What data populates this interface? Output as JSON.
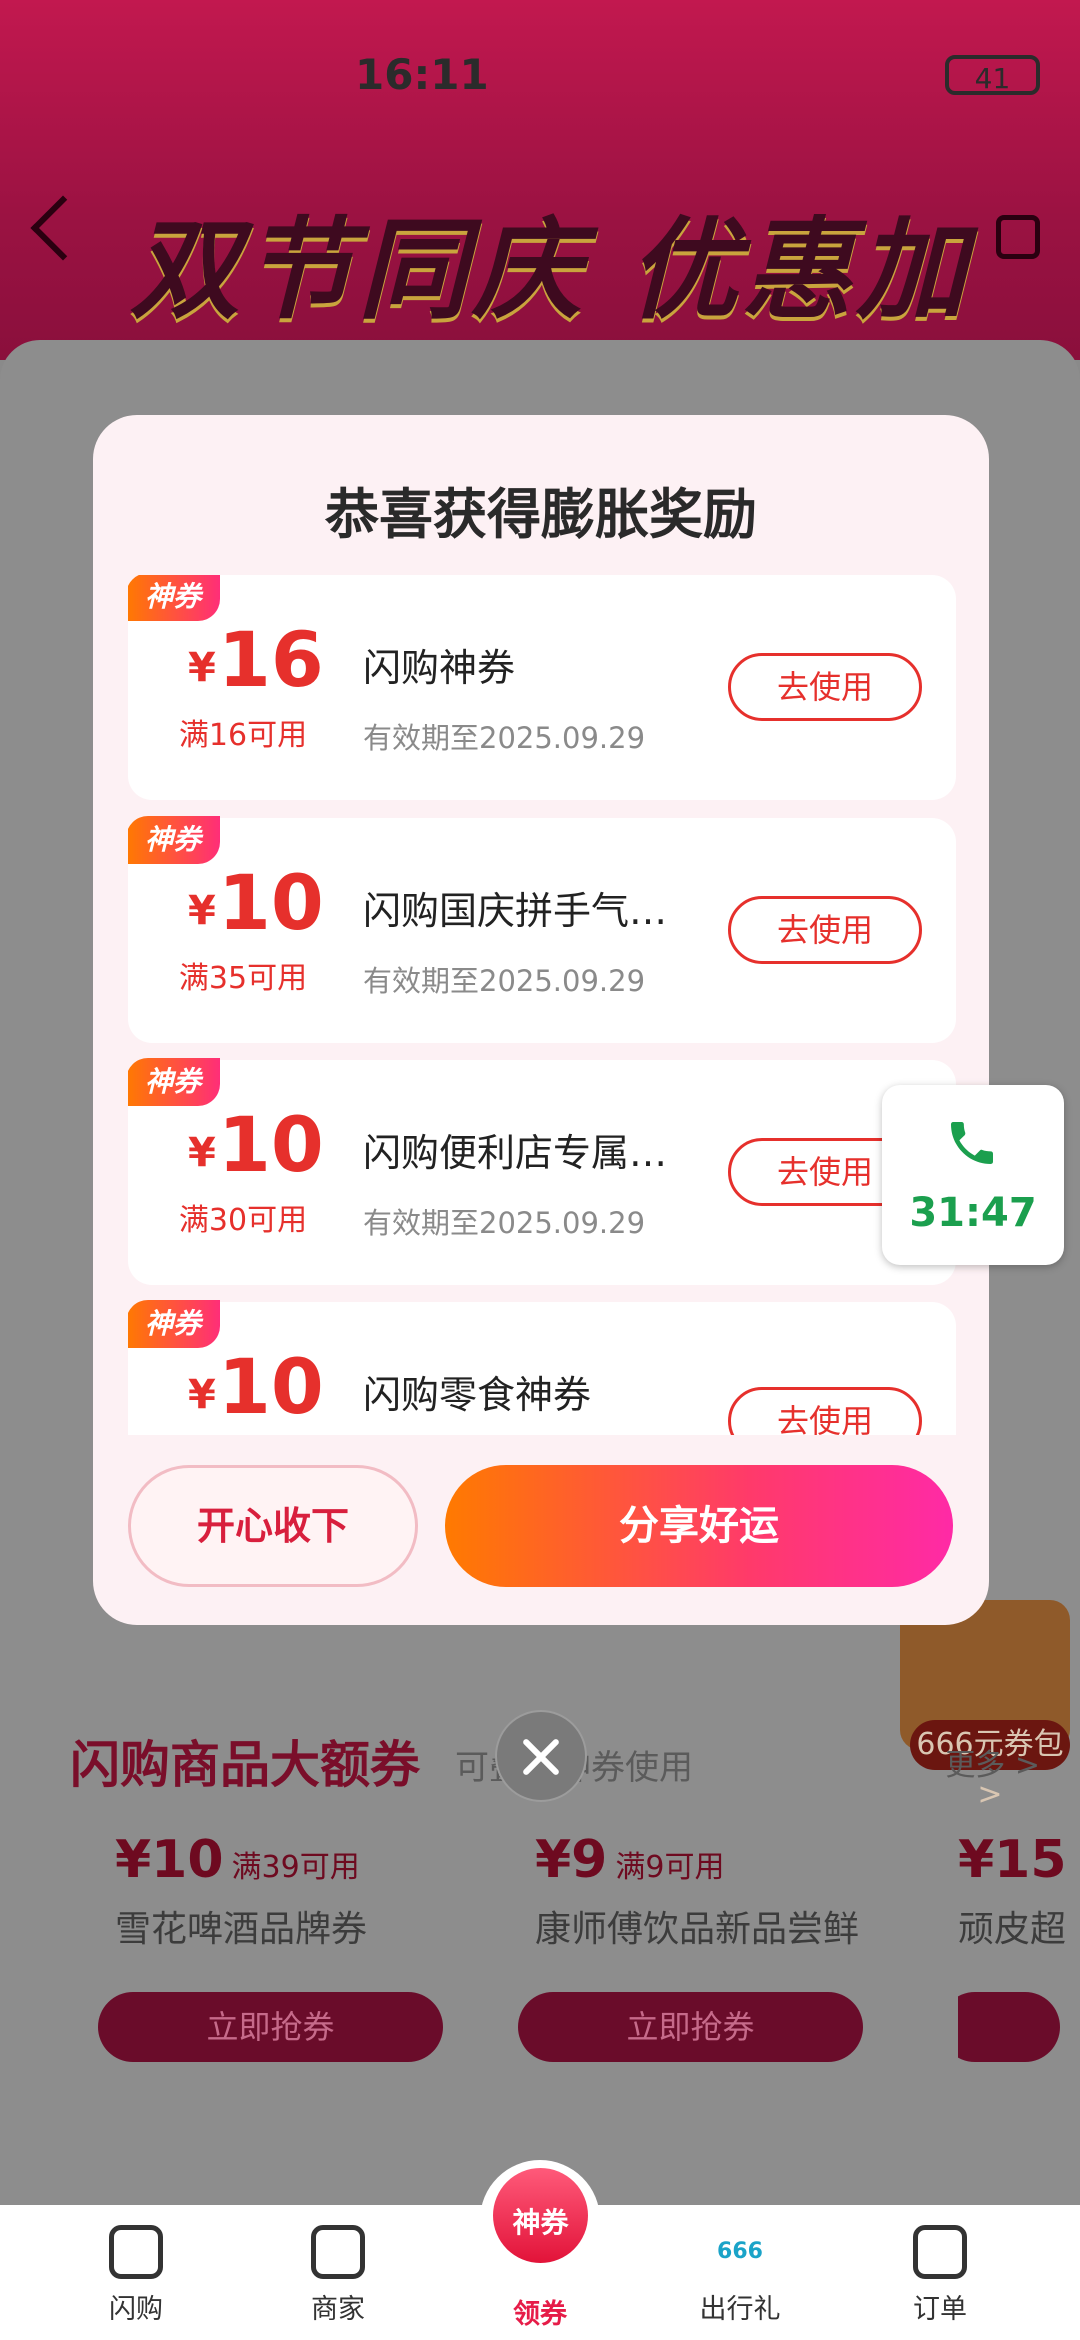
{
  "status_bar": {
    "time": "16:11",
    "battery": "41"
  },
  "banner": {
    "title": "双节同庆 优惠加倍"
  },
  "background": {
    "section_title": "闪购商品大额券",
    "section_sub": "可叠加神券使用",
    "section_more": "更多 >",
    "gift_badge_label": "666元券包>",
    "cards": [
      {
        "price": "¥10",
        "condition": "满39可用",
        "name": "雪花啤酒品牌券",
        "button": "立即抢券"
      },
      {
        "price": "¥9",
        "condition": "满9可用",
        "name": "康师傅饮品新品尝鲜",
        "button": "立即抢券"
      },
      {
        "price": "¥15",
        "condition": "",
        "name": "顽皮超",
        "button": ""
      }
    ]
  },
  "modal": {
    "title": "恭喜获得膨胀奖励",
    "coupons": [
      {
        "tag": "神券",
        "currency": "¥",
        "amount": "16",
        "condition": "满16可用",
        "title": "闪购神券",
        "valid": "有效期至2025.09.29",
        "button": "去使用"
      },
      {
        "tag": "神券",
        "currency": "¥",
        "amount": "10",
        "condition": "满35可用",
        "title": "闪购国庆拼手气…",
        "valid": "有效期至2025.09.29",
        "button": "去使用"
      },
      {
        "tag": "神券",
        "currency": "¥",
        "amount": "10",
        "condition": "满30可用",
        "title": "闪购便利店专属…",
        "valid": "有效期至2025.09.29",
        "button": "去使用"
      },
      {
        "tag": "神券",
        "currency": "¥",
        "amount": "10",
        "condition": "",
        "title": "闪购零食神券",
        "valid": "",
        "button": "去使用"
      }
    ],
    "accept_button": "开心收下",
    "share_button": "分享好运"
  },
  "call_widget": {
    "time": "31:47",
    "color": "#1b9f4e"
  },
  "tabbar": {
    "items": [
      {
        "label": "闪购",
        "icon": "bag-icon"
      },
      {
        "label": "商家",
        "icon": "store-icon"
      },
      {
        "label": "领券",
        "icon": "coupon-badge-icon",
        "badge": "神券"
      },
      {
        "label": "出行礼",
        "icon": "666-icon",
        "badge": "666"
      },
      {
        "label": "订单",
        "icon": "order-icon"
      }
    ],
    "active_color": "#e61c48"
  }
}
